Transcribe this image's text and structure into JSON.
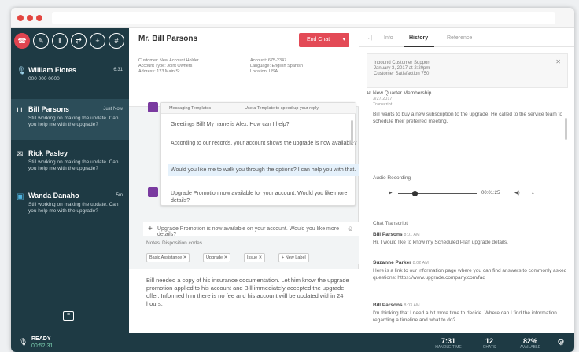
{
  "header": {
    "title": "Mr. Bill Parsons",
    "end_chat": "End Chat"
  },
  "sidebar": {
    "conversations": [
      {
        "name": "William Flores",
        "time": "6:31",
        "message": "000 000 0000"
      },
      {
        "name": "Bill Parsons",
        "time": "Just Now",
        "message": "Still working on making the update. Can you help me with the upgrade?"
      },
      {
        "name": "Rick Pasley",
        "time": "",
        "message": "Still working on making the update. Can you help me with the upgrade?"
      },
      {
        "name": "Wanda Danaho",
        "time": "5m",
        "message": "Still working on making the update. Can you help me with the upgrade?"
      }
    ],
    "status": "READY",
    "status_time": "00:52:31"
  },
  "customer_info": {
    "col1": [
      "Customer: New Account Holder",
      "Account Type: Joint Owners",
      "Address: 123 Main St."
    ],
    "col2": [
      "Account: 675-2347",
      "Language: English Spanish",
      "Location: USA"
    ]
  },
  "canned": {
    "header": "Messaging Templates",
    "header_right": "Use a Template to speed up your reply",
    "responses": [
      "Greetings Bill! My name is Alex. How can I help?",
      "According to our records, your account shows the upgrade is now available?",
      "Would you like me to walk you through the options? I can help you with that.",
      "Upgrade Promotion now available for your account. Would you like more details?"
    ],
    "input": "Upgrade Promotion is now available on your account. Would you like more details?"
  },
  "notes": {
    "label": "Notes",
    "tab": "Disposition codes",
    "tags": [
      "Basic Assistance",
      "Upgrade",
      "Issue"
    ],
    "add_tag": "+ New Label",
    "text": "Bill needed a copy of his insurance documentation. Let him know the upgrade promotion applied to his account and Bill immediately accepted the upgrade offer. Informed him there is no fee and his account will be updated within 24 hours."
  },
  "right_panel": {
    "tabs": [
      "Info",
      "History",
      "Reference"
    ],
    "email": {
      "subject": "Inbound Customer Support",
      "date": "January 3, 2017 at 2:20pm",
      "from": "Customer Satisfaction 750"
    },
    "message": {
      "title": "New Quarter Membership",
      "meta1": "3/27/2017",
      "meta2": "Transcript",
      "body": "Bill wants to buy a new subscription to the upgrade. He called to the service team to schedule their preferred meeting."
    },
    "audio_label": "Audio Recording",
    "audio_time": "00:01:25",
    "transcript_label": "Chat Transcript",
    "transcript": [
      {
        "who": "Bill Parsons",
        "time": "8:01 AM",
        "text": "Hi, I would like to know my Scheduled Plan upgrade details."
      },
      {
        "who": "Suzanne Parker",
        "time": "8:02 AM",
        "text": "Here is a link to our information page where you can find answers to commonly asked questions: https://www.upgrade.company.com/faq"
      },
      {
        "who": "Bill Parsons",
        "time": "8:03 AM",
        "text": "I'm thinking that I need a bit more time to decide. Where can I find the information regarding a timeline and what to do?"
      }
    ]
  },
  "stats": [
    {
      "value": "7:31",
      "label": "HANDLE TIME"
    },
    {
      "value": "12",
      "label": "CHATS"
    },
    {
      "value": "82%",
      "label": "AVAILABLE"
    }
  ]
}
